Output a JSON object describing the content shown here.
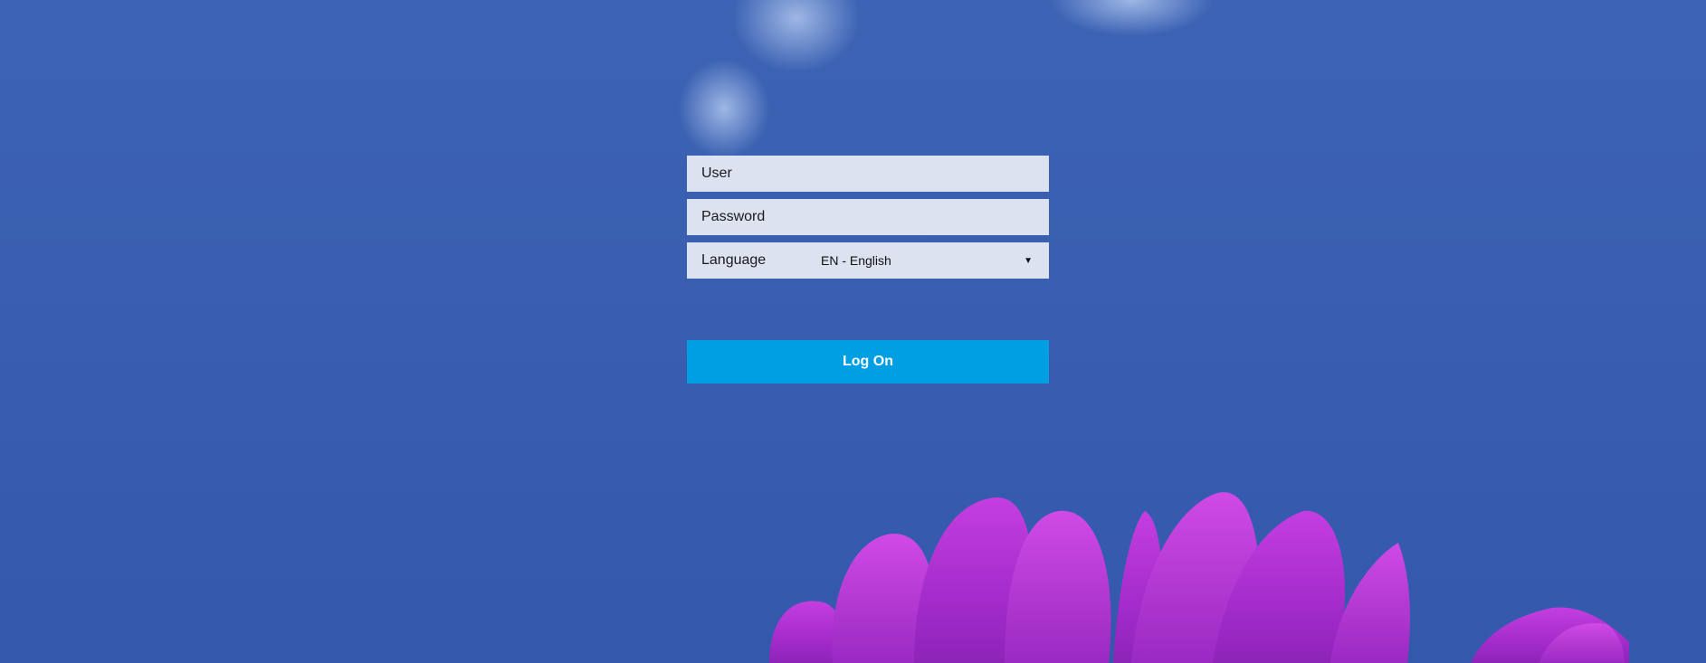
{
  "login": {
    "user_placeholder": "User",
    "password_placeholder": "Password",
    "language_label": "Language",
    "language_selected": "EN - English",
    "logon_label": "Log On"
  },
  "icons": {
    "dropdown_caret": "chevron-down-icon"
  },
  "colors": {
    "background_sky": "#3a5fb0",
    "field_background": "#e8ecf4",
    "logon_button": "#009fe3",
    "logon_text": "#ffffff",
    "flower": "#b52ed6"
  }
}
